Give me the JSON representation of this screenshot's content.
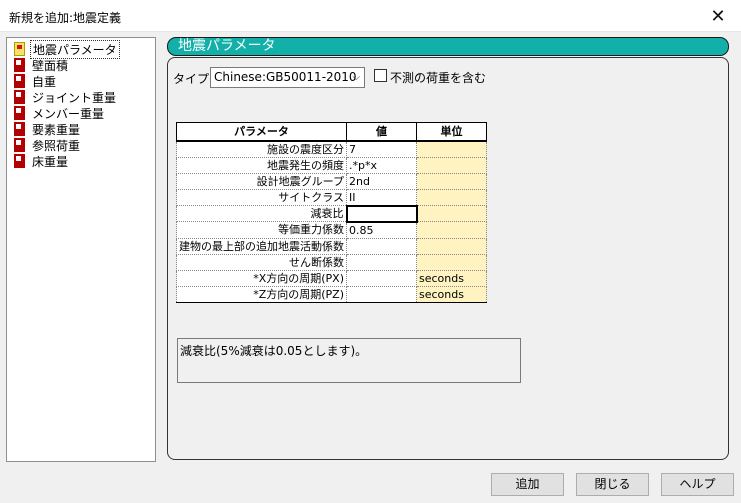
{
  "window": {
    "title": "新規を追加:地震定義",
    "close_glyph": "✕"
  },
  "tree": {
    "items": [
      {
        "label": "地震パラメータ",
        "icon": "parameter-icon-yellow",
        "selected": true
      },
      {
        "label": "壁面積",
        "icon": "load-icon-red"
      },
      {
        "label": "自重",
        "icon": "load-icon-red"
      },
      {
        "label": "ジョイント重量",
        "icon": "load-icon-red"
      },
      {
        "label": "メンバー重量",
        "icon": "load-icon-red"
      },
      {
        "label": "要素重量",
        "icon": "load-icon-red"
      },
      {
        "label": "参照荷重",
        "icon": "load-icon-red"
      },
      {
        "label": "床重量",
        "icon": "load-icon-red"
      }
    ]
  },
  "panel": {
    "header": "地震パラメータ",
    "type_label": "タイプ:",
    "type_value": "Chinese:GB50011-2010",
    "type_arrow": "⌵",
    "checkbox_label": "不測の荷重を含む",
    "checkbox_checked": false
  },
  "table": {
    "headers": [
      "パラメータ",
      "値",
      "単位"
    ],
    "rows": [
      {
        "name": "施設の震度区分",
        "value": "7",
        "unit": ""
      },
      {
        "name": "地震発生の頻度",
        "value": ".*p*x",
        "unit": ""
      },
      {
        "name": "設計地震グループ",
        "value": "2nd",
        "unit": ""
      },
      {
        "name": "サイトクラス",
        "value": "II",
        "unit": ""
      },
      {
        "name": "減衰比",
        "value": "",
        "unit": ""
      },
      {
        "name": "等価重力係数",
        "value": "0.85",
        "unit": ""
      },
      {
        "name": "建物の最上部の追加地震活動係数",
        "value": "",
        "unit": ""
      },
      {
        "name": "せん断係数",
        "value": "",
        "unit": ""
      },
      {
        "name": "*X方向の周期(PX)",
        "value": "",
        "unit": "seconds"
      },
      {
        "name": "*Z方向の周期(PZ)",
        "value": "",
        "unit": "seconds"
      }
    ]
  },
  "description": "減衰比(5%減衰は0.05とします)。",
  "buttons": {
    "add": "追加",
    "close": "閉じる",
    "help": "ヘルプ"
  },
  "colors": {
    "header_bar": "#12b0a8",
    "unit_cell": "#fff3c2",
    "load_icon": "#b40000"
  }
}
